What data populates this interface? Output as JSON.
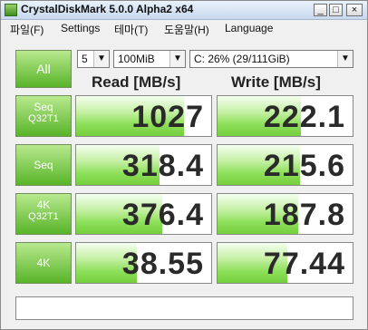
{
  "window": {
    "title": "CrystalDiskMark 5.0.0 Alpha2 x64"
  },
  "menu": [
    {
      "label": "파일(F)"
    },
    {
      "label": "Settings"
    },
    {
      "label": "테마(T)"
    },
    {
      "label": "도움말(H)"
    },
    {
      "label": "Language"
    }
  ],
  "controls": {
    "all_label": "All",
    "count_value": "5",
    "size_value": "100MiB",
    "drive_value": "C: 26% (29/111GiB)"
  },
  "headers": {
    "read": "Read [MB/s]",
    "write": "Write [MB/s]"
  },
  "rows": [
    {
      "label": "Seq",
      "sublabel": "Q32T1",
      "read": "1027",
      "write": "222.1",
      "read_fill": 0.8,
      "write_fill": 0.62
    },
    {
      "label": "Seq",
      "sublabel": "",
      "read": "318.4",
      "write": "215.6",
      "read_fill": 0.62,
      "write_fill": 0.61
    },
    {
      "label": "4K",
      "sublabel": "Q32T1",
      "read": "376.4",
      "write": "187.8",
      "read_fill": 0.64,
      "write_fill": 0.6
    },
    {
      "label": "4K",
      "sublabel": "",
      "read": "38.55",
      "write": "77.44",
      "read_fill": 0.45,
      "write_fill": 0.52
    }
  ],
  "comment": ""
}
